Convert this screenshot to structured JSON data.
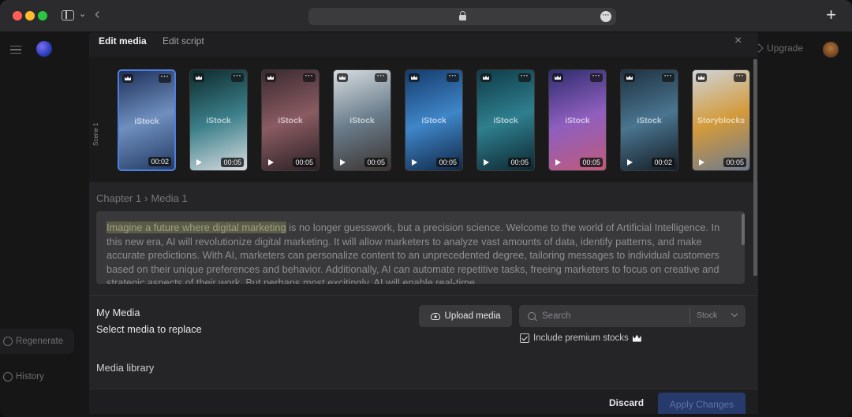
{
  "browser": {
    "url_icon": "lock-icon",
    "new_tab": "+",
    "back": "‹"
  },
  "app": {
    "upgrade_label": "Upgrade",
    "sidebar": {
      "regenerate": "Regenerate",
      "history": "History"
    }
  },
  "modal": {
    "tabs": [
      "Edit media",
      "Edit script"
    ],
    "close": "×",
    "scene_label": "Scene 1",
    "thumbnails": [
      {
        "watermark": "iStock",
        "duration": "00:02",
        "selected": true,
        "colors": [
          "#1c2f57",
          "#6f8fbf",
          "#233a63"
        ]
      },
      {
        "watermark": "iStock",
        "duration": "00:05",
        "selected": false,
        "colors": [
          "#0d2a2c",
          "#3c7f8a",
          "#d8dde0"
        ]
      },
      {
        "watermark": "iStock",
        "duration": "00:05",
        "selected": false,
        "colors": [
          "#3a2a30",
          "#8a5b62",
          "#2a2024"
        ]
      },
      {
        "watermark": "iStock",
        "duration": "00:05",
        "selected": false,
        "colors": [
          "#d8dde0",
          "#6a7d8c",
          "#3b3330"
        ]
      },
      {
        "watermark": "iStock",
        "duration": "00:05",
        "selected": false,
        "colors": [
          "#153b6b",
          "#3f86c9",
          "#102746"
        ]
      },
      {
        "watermark": "iStock",
        "duration": "00:05",
        "selected": false,
        "colors": [
          "#0f3b46",
          "#2f7f8f",
          "#0d2730"
        ]
      },
      {
        "watermark": "iStock",
        "duration": "00:05",
        "selected": false,
        "colors": [
          "#2e2d6d",
          "#8f5fbf",
          "#c05a7a"
        ]
      },
      {
        "watermark": "iStock",
        "duration": "00:02",
        "selected": false,
        "colors": [
          "#1e3140",
          "#4a7590",
          "#141c24"
        ]
      },
      {
        "watermark": "Storyblocks",
        "duration": "00:05",
        "selected": false,
        "colors": [
          "#cfd4da",
          "#d39a3a",
          "#6d7a90"
        ]
      }
    ],
    "breadcrumb": {
      "chapter": "Chapter 1",
      "separator": "›",
      "media": "Media 1"
    },
    "script": {
      "highlight": "Imagine a future where digital marketing",
      "rest": " is no longer guesswork, but a precision science. Welcome to the world of Artificial Intelligence. In this new era, AI will revolutionize digital marketing. It will allow marketers to analyze vast amounts of data, identify patterns, and make accurate predictions. With AI, marketers can personalize content to an unprecedented degree, tailoring messages to individual customers based on their unique preferences and behavior. Additionally, AI can automate repetitive tasks, freeing marketers to focus on creative and strategic aspects of their work. But perhaps most excitingly, AI will enable real-time"
    },
    "my_media": {
      "title": "My Media",
      "hint": "Select media to replace"
    },
    "upload_label": "Upload media",
    "search": {
      "placeholder": "Search",
      "source": "Stock"
    },
    "premium_label": "Include premium stocks",
    "media_library": "Media library",
    "footer": {
      "discard": "Discard",
      "apply": "Apply Changes"
    }
  }
}
